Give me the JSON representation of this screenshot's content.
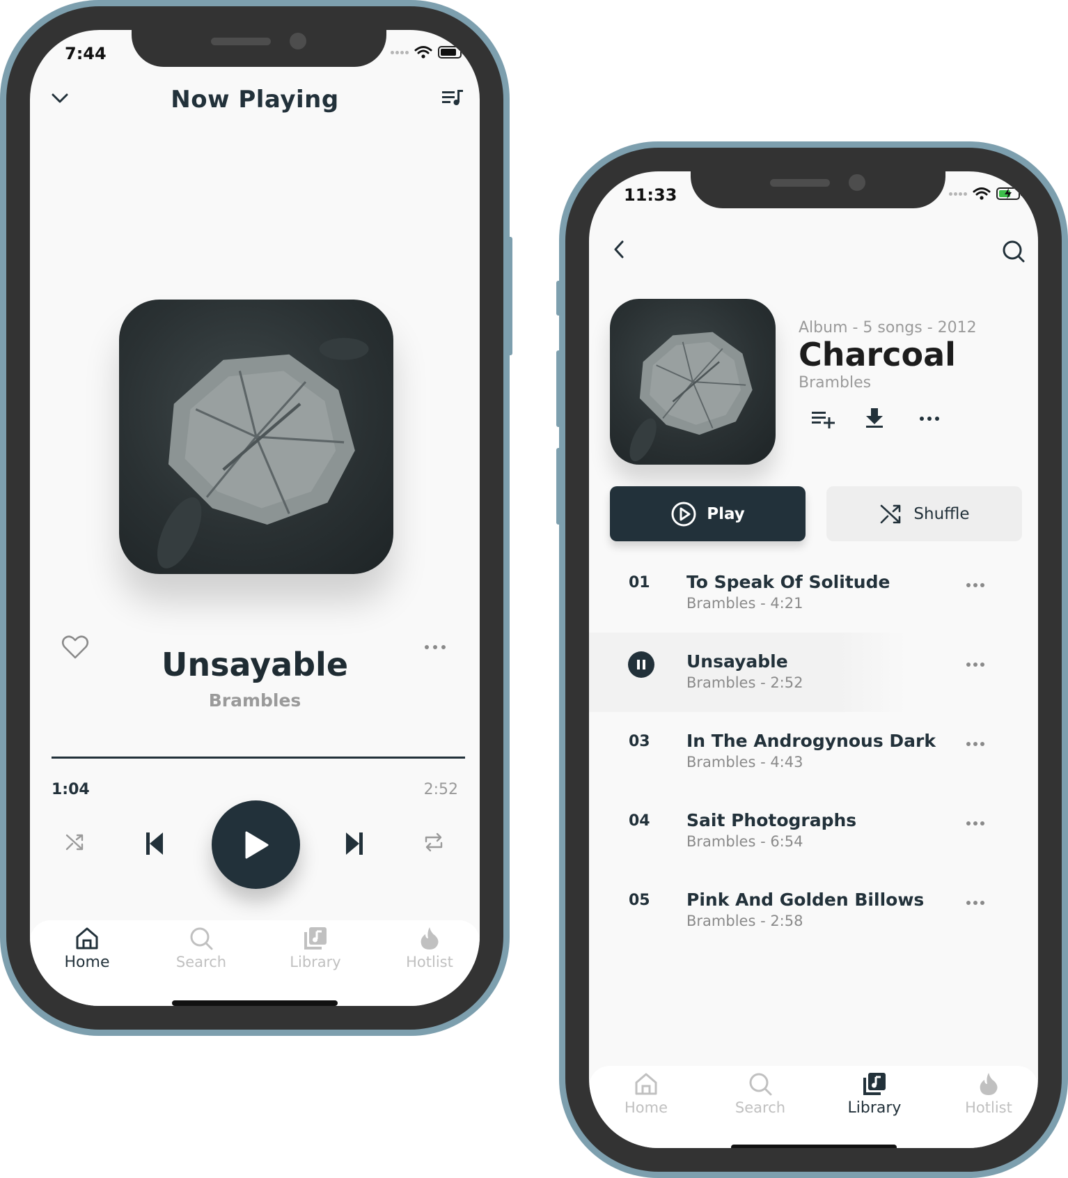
{
  "now_playing": {
    "status_time": "7:44",
    "header_title": "Now Playing",
    "song": {
      "title": "Unsayable",
      "artist": "Brambles"
    },
    "progress": {
      "elapsed": "1:04",
      "total": "2:52",
      "fraction": 1.0
    },
    "tabs": [
      {
        "label": "Home",
        "icon": "home-icon",
        "active": true
      },
      {
        "label": "Search",
        "icon": "search-icon",
        "active": false
      },
      {
        "label": "Library",
        "icon": "library-icon",
        "active": false
      },
      {
        "label": "Hotlist",
        "icon": "flame-icon",
        "active": false
      }
    ]
  },
  "album": {
    "status_time": "11:33",
    "meta": "Album - 5 songs - 2012",
    "title": "Charcoal",
    "artist": "Brambles",
    "play_label": "Play",
    "shuffle_label": "Shuffle",
    "tracks": [
      {
        "number": "01",
        "title": "To Speak Of Solitude",
        "subtitle": "Brambles - 4:21",
        "playing": false
      },
      {
        "number": "02",
        "title": "Unsayable",
        "subtitle": "Brambles - 2:52",
        "playing": true
      },
      {
        "number": "03",
        "title": "In The Androgynous Dark",
        "subtitle": "Brambles - 4:43",
        "playing": false
      },
      {
        "number": "04",
        "title": "Sait Photographs",
        "subtitle": "Brambles - 6:54",
        "playing": false
      },
      {
        "number": "05",
        "title": "Pink And Golden Billows",
        "subtitle": "Brambles - 2:58",
        "playing": false
      }
    ],
    "tabs": [
      {
        "label": "Home",
        "icon": "home-icon",
        "active": false
      },
      {
        "label": "Search",
        "icon": "search-icon",
        "active": false
      },
      {
        "label": "Library",
        "icon": "library-icon",
        "active": true
      },
      {
        "label": "Hotlist",
        "icon": "flame-icon",
        "active": false
      }
    ]
  },
  "colors": {
    "primary": "#22313a",
    "frame": "#7d9fae",
    "bezel": "#333333",
    "screen_bg": "#f9f9f9",
    "muted_text": "#9a9a9a",
    "battery_charging": "#3dbf4a"
  }
}
